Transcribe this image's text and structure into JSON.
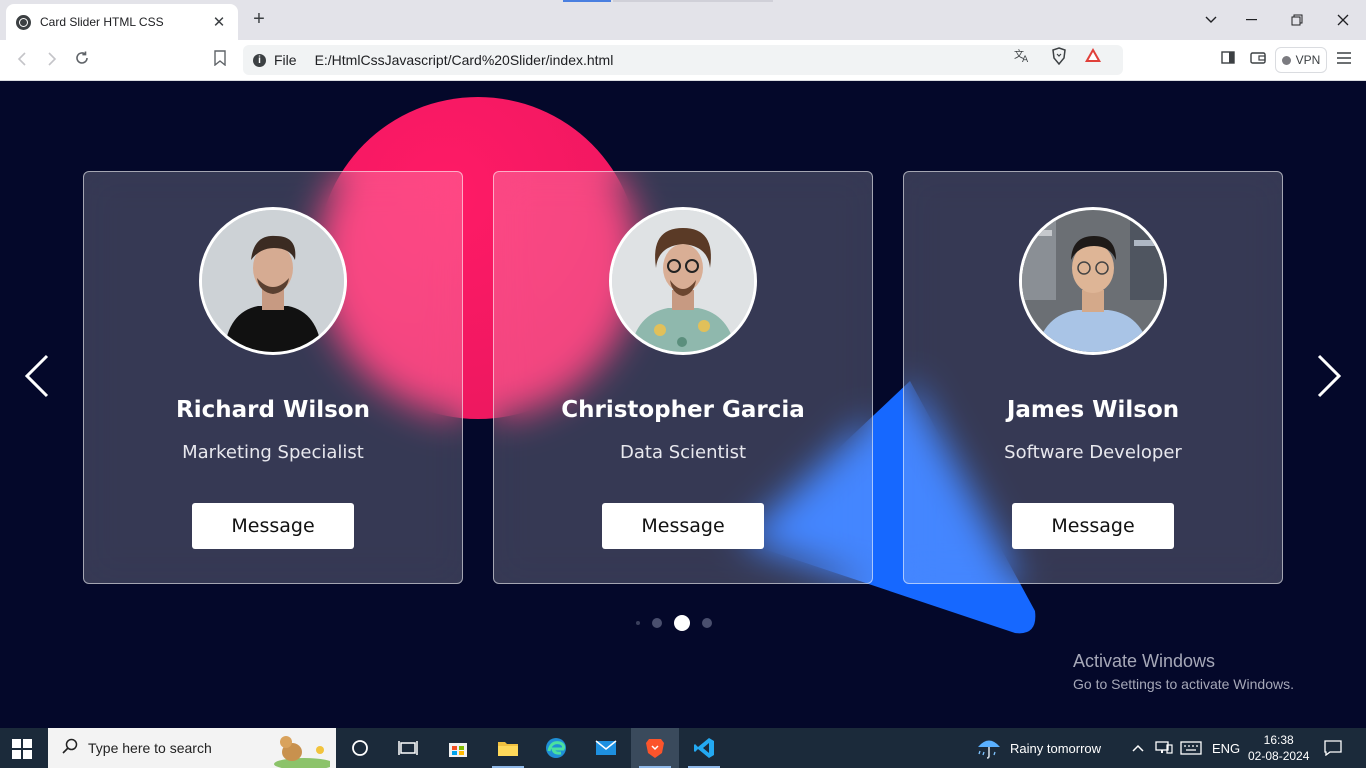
{
  "browser": {
    "tab_title": "Card Slider HTML CSS",
    "tab_close": "✕",
    "new_tab": "+",
    "site_info": "File",
    "url": "E:/HtmlCssJavascript/Card%20Slider/index.html",
    "rewards_count": "1",
    "vpn_label": "VPN"
  },
  "cards": [
    {
      "name": "Richard Wilson",
      "role": "Marketing Specialist",
      "button": "Message"
    },
    {
      "name": "Christopher Garcia",
      "role": "Data Scientist",
      "button": "Message"
    },
    {
      "name": "James Wilson",
      "role": "Software Developer",
      "button": "Message"
    }
  ],
  "pagination": {
    "total": 4,
    "active_index": 2
  },
  "watermark": {
    "title": "Activate Windows",
    "subtitle": "Go to Settings to activate Windows."
  },
  "taskbar": {
    "search_placeholder": "Type here to search",
    "weather": "Rainy tomorrow",
    "language": "ENG",
    "time": "16:38",
    "date": "02-08-2024"
  },
  "colors": {
    "page_bg": "#04082a",
    "pink_shape": "#ff1a66",
    "blue_shape": "#1a6cff"
  }
}
